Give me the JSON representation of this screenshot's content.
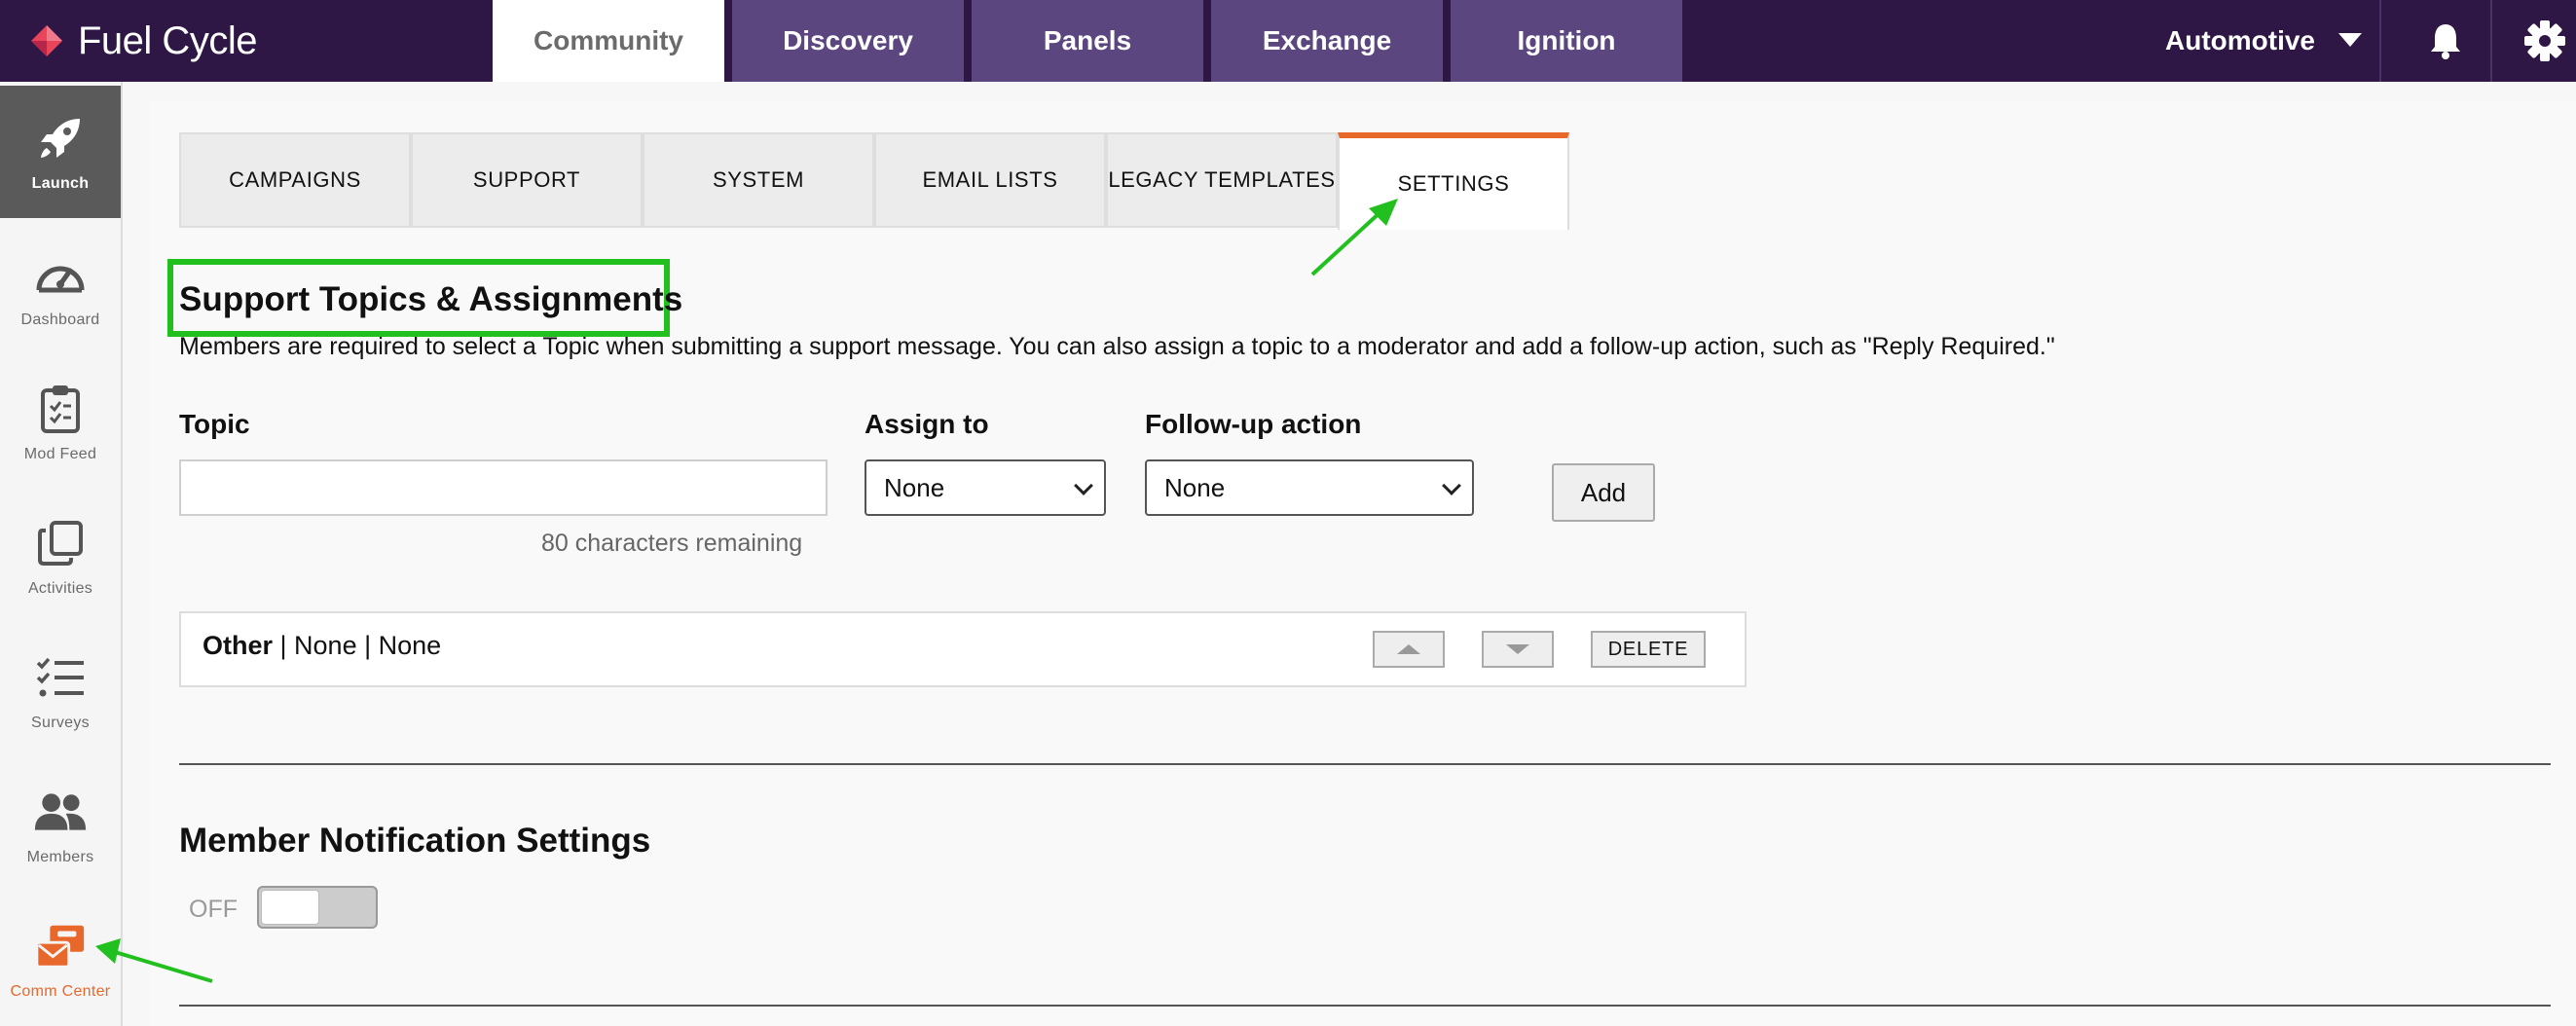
{
  "topbar": {
    "logo_text": "Fuel Cycle",
    "tabs": [
      {
        "label": "Community",
        "active": true
      },
      {
        "label": "Discovery",
        "active": false
      },
      {
        "label": "Panels",
        "active": false
      },
      {
        "label": "Exchange",
        "active": false
      },
      {
        "label": "Ignition",
        "active": false
      }
    ],
    "org_select": "Automotive",
    "icons": [
      "bell-icon",
      "gear-icon"
    ]
  },
  "sidebar": {
    "items": [
      {
        "label": "Launch",
        "icon": "rocket-icon",
        "active": true
      },
      {
        "label": "Dashboard",
        "icon": "speedometer-icon"
      },
      {
        "label": "Mod Feed",
        "icon": "clipboard-check-icon"
      },
      {
        "label": "Activities",
        "icon": "copy-stack-icon"
      },
      {
        "label": "Surveys",
        "icon": "checklist-icon"
      },
      {
        "label": "Members",
        "icon": "users-icon"
      },
      {
        "label": "Comm Center",
        "icon": "mail-briefcase-icon"
      }
    ]
  },
  "subtabs": [
    {
      "label": "CAMPAIGNS"
    },
    {
      "label": "SUPPORT"
    },
    {
      "label": "SYSTEM"
    },
    {
      "label": "EMAIL LISTS"
    },
    {
      "label": "LEGACY TEMPLATES"
    },
    {
      "label": "SETTINGS",
      "active": true
    }
  ],
  "support_topics": {
    "title": "Support Topics & Assignments",
    "description": "Members are required to select a Topic when submitting a support message. You can also assign a topic to a moderator and add a follow-up action, such as \"Reply Required.\"",
    "topic_label": "Topic",
    "topic_value": "",
    "chars_remaining": "80 characters remaining",
    "assign_label": "Assign to",
    "assign_value": "None",
    "followup_label": "Follow-up action",
    "followup_value": "None",
    "add_button": "Add",
    "rows": [
      {
        "name": "Other",
        "rest": " | None | None",
        "delete_label": "DELETE"
      }
    ]
  },
  "notifications": {
    "title": "Member Notification Settings",
    "toggle_label": "OFF",
    "toggle_on": false
  },
  "colors": {
    "topbar_bg": "#2e1745",
    "tab_bg": "#5b4680",
    "accent_orange": "#e8672b",
    "annotation_green": "#22c01f"
  }
}
